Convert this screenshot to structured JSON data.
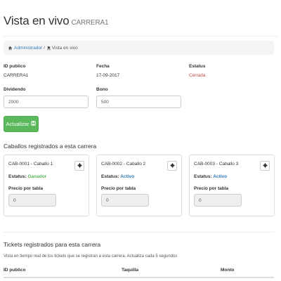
{
  "header": {
    "title": "Vista en vivo",
    "subtitle": "CARRERA1"
  },
  "breadcrumb": {
    "home_label": "Administrador",
    "separator": "/",
    "current_label": "Vista en vivo"
  },
  "info": {
    "id_label": "ID publico",
    "id_value": "CARRERA1",
    "fecha_label": "Fecha",
    "fecha_value": "17-09-2017",
    "estatus_label": "Estatus",
    "estatus_value": "Cerrada",
    "dividendo_label": "Dividendo",
    "dividendo_value": "2000",
    "bono_label": "Bono",
    "bono_value": "500"
  },
  "update_button": {
    "label": "Actualizar"
  },
  "horses_section": {
    "title": "Caballos registrados a esta carrera",
    "cards": [
      {
        "title": "CAB-0001 - Caballo 1",
        "estatus_label": "Estatus:",
        "estatus_value": "Ganador",
        "precio_label": "Precio por tabla",
        "precio_value": "0"
      },
      {
        "title": "CAB-0002 - Caballo 2",
        "estatus_label": "Estatus:",
        "estatus_value": "Activo",
        "precio_label": "Precio por tabla",
        "precio_value": "0"
      },
      {
        "title": "CAB-0003 - Caballo 3",
        "estatus_label": "Estatus:",
        "estatus_value": "Activo",
        "precio_label": "Precio por tabla",
        "precio_value": "0"
      }
    ]
  },
  "tickets_section": {
    "title": "Tickets registrados para esta carrera",
    "description": "Vista en tiempo real de los tickets que se registran a esta carrera. Actualiza cada 5 segundos",
    "columns": [
      "ID publico",
      "Taquilla",
      "Monto"
    ]
  },
  "colors": {
    "success": "#5cb85c",
    "link": "#337ab7",
    "danger": "#b94a48"
  }
}
